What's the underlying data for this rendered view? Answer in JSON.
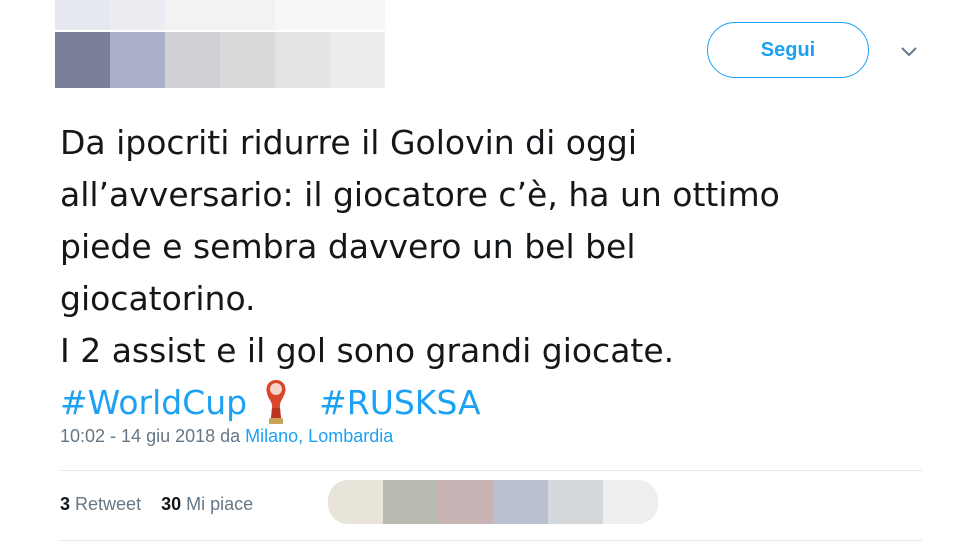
{
  "header": {
    "follow_label": "Segui",
    "caret_icon": "chevron-down-icon"
  },
  "tweet": {
    "lines": [
      "Da ipocriti ridurre il Golovin di oggi",
      "all’avversario: il giocatore c’è, ha un ottimo",
      "piede e sembra davvero un bel bel",
      "giocatorino.",
      "I 2 assist e il gol sono grandi giocate."
    ],
    "hashtag_1": "#WorldCup",
    "emoji_icon": "world-cup-trophy-icon",
    "hashtag_2": "#RUSKSA"
  },
  "meta": {
    "time": "10:02 - 14 giu 2018 da ",
    "place": "Milano, Lombardia"
  },
  "stats": {
    "retweet_count": "3",
    "retweet_label": "Retweet",
    "like_count": "30",
    "like_label": "Mi piace"
  },
  "colors": {
    "accent": "#1da1f2",
    "text": "#14171a",
    "muted": "#657786",
    "divider": "#e1e8ed"
  }
}
